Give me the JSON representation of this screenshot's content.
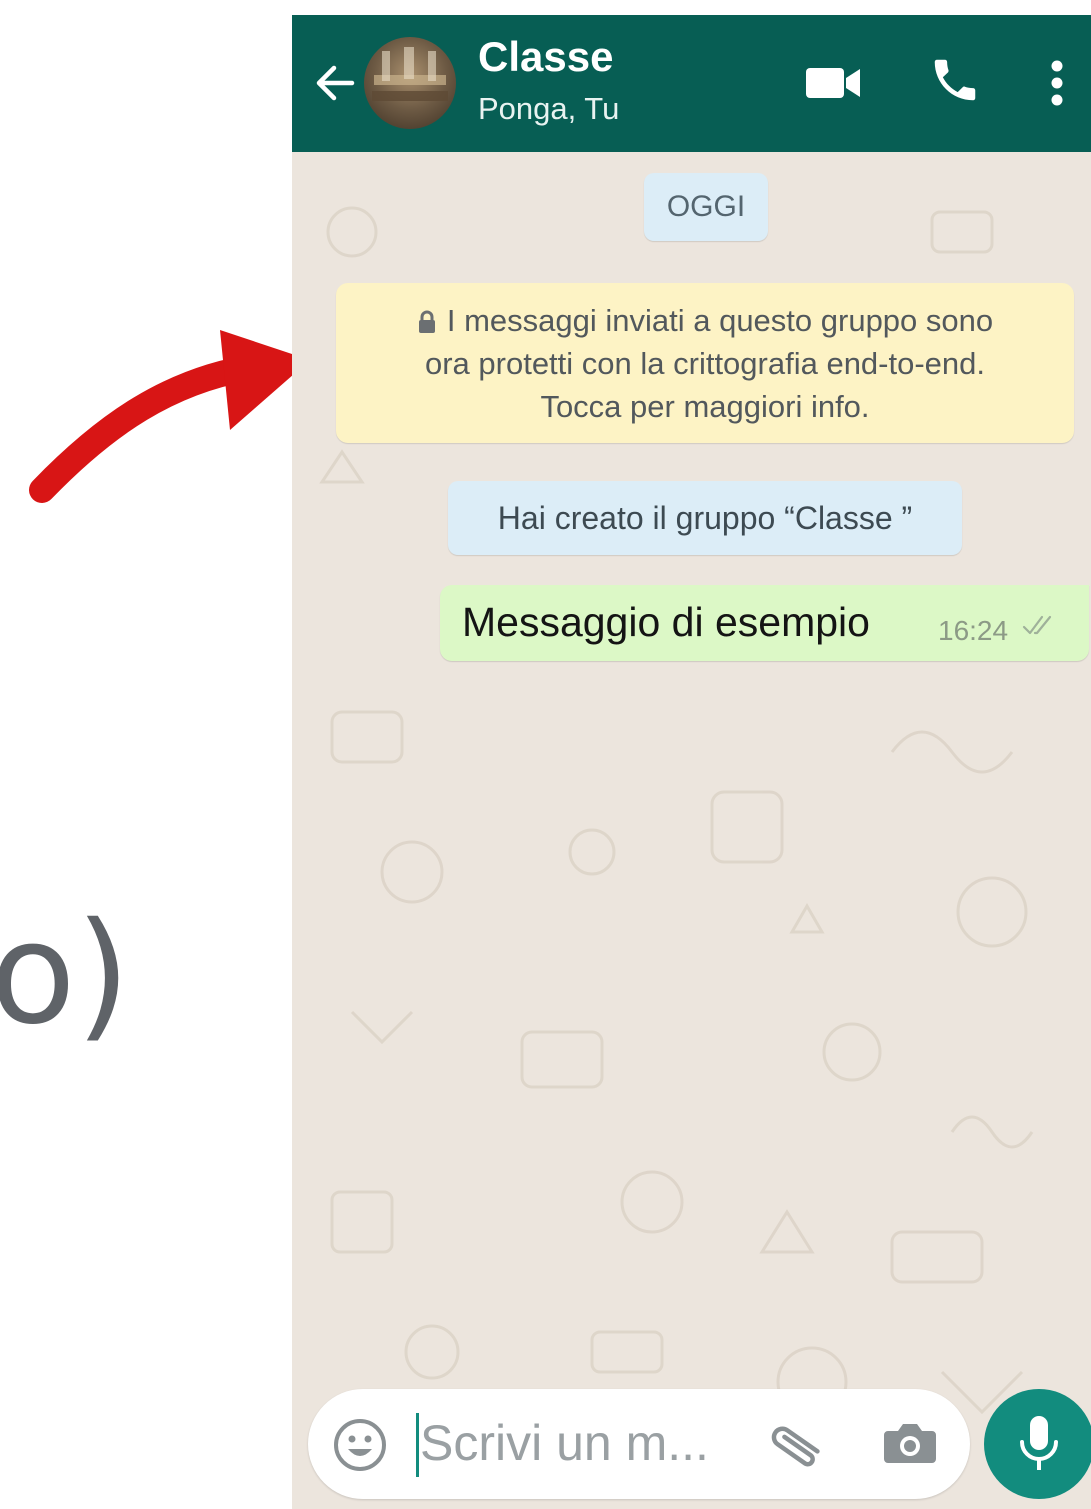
{
  "left_fragment": "o)",
  "header": {
    "title": "Classe",
    "subtitle": "Ponga, Tu",
    "back_icon": "arrow-left-icon",
    "video_icon": "video-call-icon",
    "call_icon": "phone-icon",
    "menu_icon": "more-vert-icon",
    "color": "#075e54"
  },
  "chat": {
    "date_chip": "OGGI",
    "encryption_notice": {
      "line1": "I messaggi inviati a questo gruppo sono",
      "line2": "ora protetti con la crittografia end-to-end.",
      "line3": "Tocca per maggiori info.",
      "icon": "lock-icon"
    },
    "system_message": "Hai creato il gruppo “Classe ”",
    "messages": [
      {
        "text": "Messaggio di esempio",
        "time": "16:24",
        "status": "read-double-check"
      }
    ]
  },
  "composer": {
    "placeholder": "Scrivi un m...",
    "emoji_icon": "emoji-icon",
    "attach_icon": "paperclip-icon",
    "camera_icon": "camera-icon",
    "mic_icon": "microphone-icon"
  },
  "colors": {
    "accent": "#128c7e",
    "chat_bg": "#ece5dd",
    "outgoing_bubble": "#dcf8c6",
    "notice_bg": "#fdf3c5",
    "annotation_arrow": "#d81515"
  }
}
